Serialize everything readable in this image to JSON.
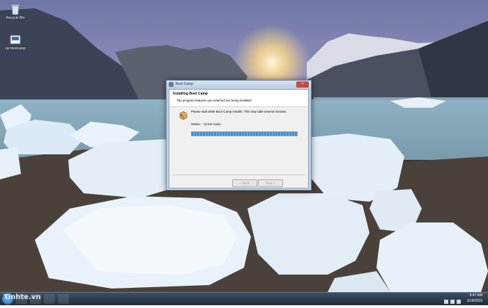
{
  "desktop": {
    "icons": [
      {
        "label": "Recycle Bin",
        "icon": "recycle-bin-icon"
      },
      {
        "label": "cai bootcamp",
        "icon": "folder-icon"
      }
    ]
  },
  "window": {
    "title": "Boot Camp",
    "header_title": "Installing Boot Camp",
    "header_subtitle": "The program features you selected are being installed.",
    "message": "Please wait while Boot Camp installs. This may take several minutes.",
    "status_label": "Status:",
    "status_value": "Cirrus Audio",
    "progress_fraction": 1.0,
    "back_label": "< Back",
    "next_label": "Next >",
    "close_glyph": "×"
  },
  "taskbar": {
    "time": "9:47 AM",
    "date": "3/18/2015",
    "watermark": "Tinhte.vn"
  },
  "colors": {
    "progress": "#3f8fd9",
    "titlebar": "#c9d9ec",
    "close_button": "#c84a3e"
  }
}
